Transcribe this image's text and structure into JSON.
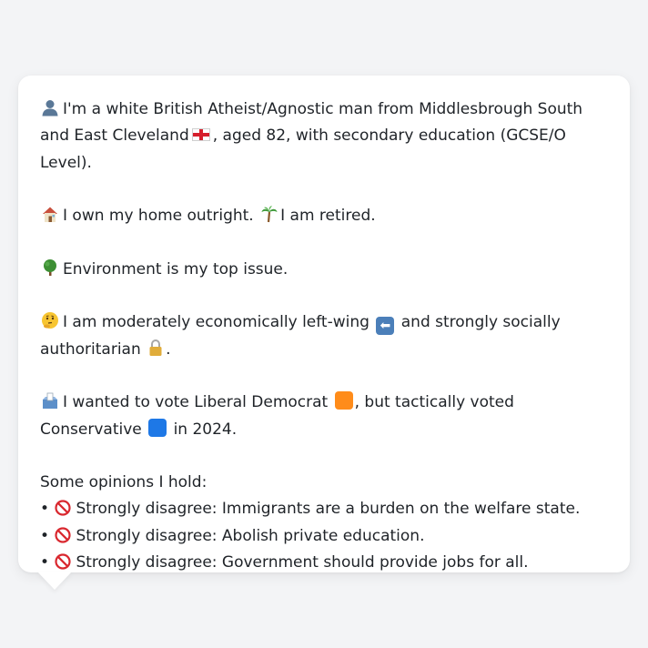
{
  "profile": {
    "line1": {
      "icon": "person-silhouette-icon",
      "text_a": "I'm a white British Atheist/Agnostic man from Middlesbrough South and East Cleveland",
      "flag": "england-flag-icon",
      "text_b": ", aged 82, with secondary education (GCSE/O Level)."
    },
    "line2": {
      "home_icon": "house-icon",
      "home_text": "I own my home outright.",
      "retired_icon": "palm-tree-icon",
      "retired_text": "I am retired."
    },
    "line3": {
      "icon": "tree-icon",
      "text": "Environment is my top issue."
    },
    "line4": {
      "icon": "thinking-face-icon",
      "text_a": "I am moderately economically left-wing",
      "arrow_icon": "left-arrow-icon",
      "text_b": "and strongly socially authoritarian",
      "lock_icon": "lock-icon",
      "text_c": "."
    },
    "line5": {
      "icon": "ballot-box-icon",
      "text_a": "I wanted to vote Liberal Democrat",
      "libdem_color": "#ff8c1a",
      "text_b": ", but tactically voted Conservative",
      "con_color": "#1e78e6",
      "text_c": "in 2024."
    }
  },
  "opinions": {
    "heading": "Some opinions I hold:",
    "bullet": "•",
    "icon": "prohibited-icon",
    "items": [
      {
        "text": "Strongly disagree: Immigrants are a burden on the welfare state."
      },
      {
        "text": "Strongly disagree: Abolish private education."
      },
      {
        "text": "Strongly disagree: Government should provide jobs for all."
      }
    ]
  },
  "colors": {
    "background": "#f3f4f6",
    "card": "#ffffff",
    "text": "#1f2328"
  }
}
